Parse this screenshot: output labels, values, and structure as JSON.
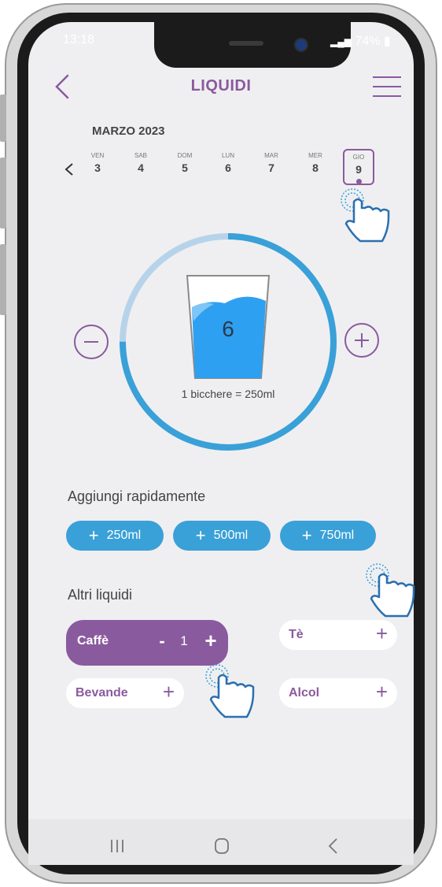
{
  "status": {
    "time": "13:18",
    "battery": "74%"
  },
  "header": {
    "title": "LIQUIDI"
  },
  "calendar": {
    "month": "MARZO 2023",
    "days": [
      {
        "name": "VEN",
        "num": "3"
      },
      {
        "name": "SAB",
        "num": "4"
      },
      {
        "name": "DOM",
        "num": "5"
      },
      {
        "name": "LUN",
        "num": "6"
      },
      {
        "name": "MAR",
        "num": "7"
      },
      {
        "name": "MER",
        "num": "8"
      },
      {
        "name": "GIO",
        "num": "9"
      }
    ],
    "selected_day": "9"
  },
  "tracker": {
    "glasses": "6",
    "caption": "1 bicchere = 250ml",
    "progress": 0.75
  },
  "quick_add": {
    "title": "Aggiungi rapidamente",
    "buttons": [
      "250ml",
      "500ml",
      "750ml"
    ],
    "plus_symbol": "+"
  },
  "other_liquids": {
    "title": "Altri liquidi",
    "active": {
      "label": "Caffè",
      "minus": "-",
      "count": "1",
      "plus": "+"
    },
    "chips": [
      {
        "label": "Tè",
        "plus": "+"
      },
      {
        "label": "Bevande",
        "plus": "+"
      },
      {
        "label": "Alcol",
        "plus": "+"
      }
    ]
  },
  "colors": {
    "accent": "#8a5a9e",
    "water": "#3aa0d8",
    "background": "#efeff1"
  },
  "icons": [
    "back-icon",
    "menu-icon",
    "chevron-left-icon",
    "minus-icon",
    "plus-icon",
    "hand-pointer-icon",
    "recent-apps-icon",
    "home-icon",
    "back-nav-icon"
  ]
}
